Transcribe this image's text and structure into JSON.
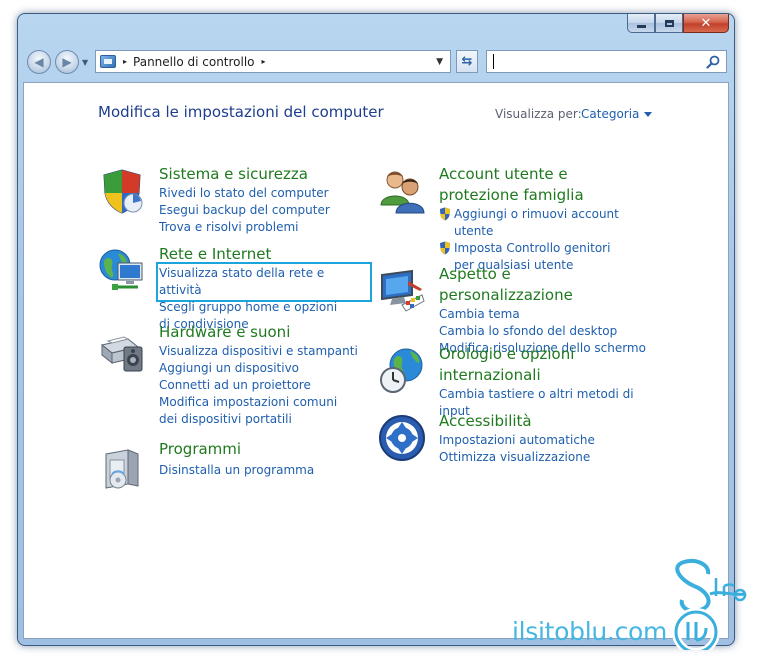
{
  "window": {
    "caption_buttons": [
      "minimize",
      "maximize",
      "close"
    ]
  },
  "navigation": {
    "breadcrumb_sep": "▸",
    "address_text": "Pannello di controllo",
    "search_value": ""
  },
  "header": {
    "title": "Modifica le impostazioni del computer",
    "view_label": "Visualizza per:",
    "view_value": "Categoria"
  },
  "categories": {
    "sistema": {
      "title": "Sistema e sicurezza",
      "icon": "security-shield-icon",
      "links": [
        "Rivedi lo stato del computer",
        "Esegui backup del computer",
        "Trova e risolvi problemi"
      ]
    },
    "rete": {
      "title": "Rete e Internet",
      "icon": "network-globe-icon",
      "links": [
        "Visualizza stato della rete e attività",
        "Scegli gruppo home e opzioni di condivisione"
      ]
    },
    "hardware": {
      "title": "Hardware e suoni",
      "icon": "printer-speaker-icon",
      "links": [
        "Visualizza dispositivi e stampanti",
        "Aggiungi un dispositivo",
        "Connetti ad un proiettore",
        "Modifica impostazioni comuni dei dispositivi portatili"
      ]
    },
    "programmi": {
      "title": "Programmi",
      "icon": "programs-box-icon",
      "links": [
        "Disinstalla un programma"
      ]
    },
    "account": {
      "title": "Account utente e protezione famiglia",
      "icon": "users-icon",
      "links": [
        "Aggiungi o rimuovi account utente",
        "Imposta Controllo genitori per qualsiasi utente"
      ]
    },
    "aspetto": {
      "title": "Aspetto e personalizzazione",
      "icon": "monitor-palette-icon",
      "links": [
        "Cambia tema",
        "Cambia lo sfondo del desktop",
        "Modifica risoluzione dello schermo"
      ]
    },
    "orologio": {
      "title": "Orologio e opzioni internazionali",
      "icon": "clock-globe-icon",
      "links": [
        "Cambia tastiere o altri metodi di input"
      ]
    },
    "accessibilita": {
      "title": "Accessibilità",
      "icon": "accessibility-icon",
      "links": [
        "Impostazioni automatiche",
        "Ottimizza visualizzazione"
      ]
    }
  },
  "watermark": {
    "text": "ilsitoblu.com"
  },
  "colors": {
    "title_blue": "#1e3e8c",
    "link_blue": "#1f5fae",
    "category_green": "#1f7a1f",
    "highlight": "#1aa6dc"
  }
}
